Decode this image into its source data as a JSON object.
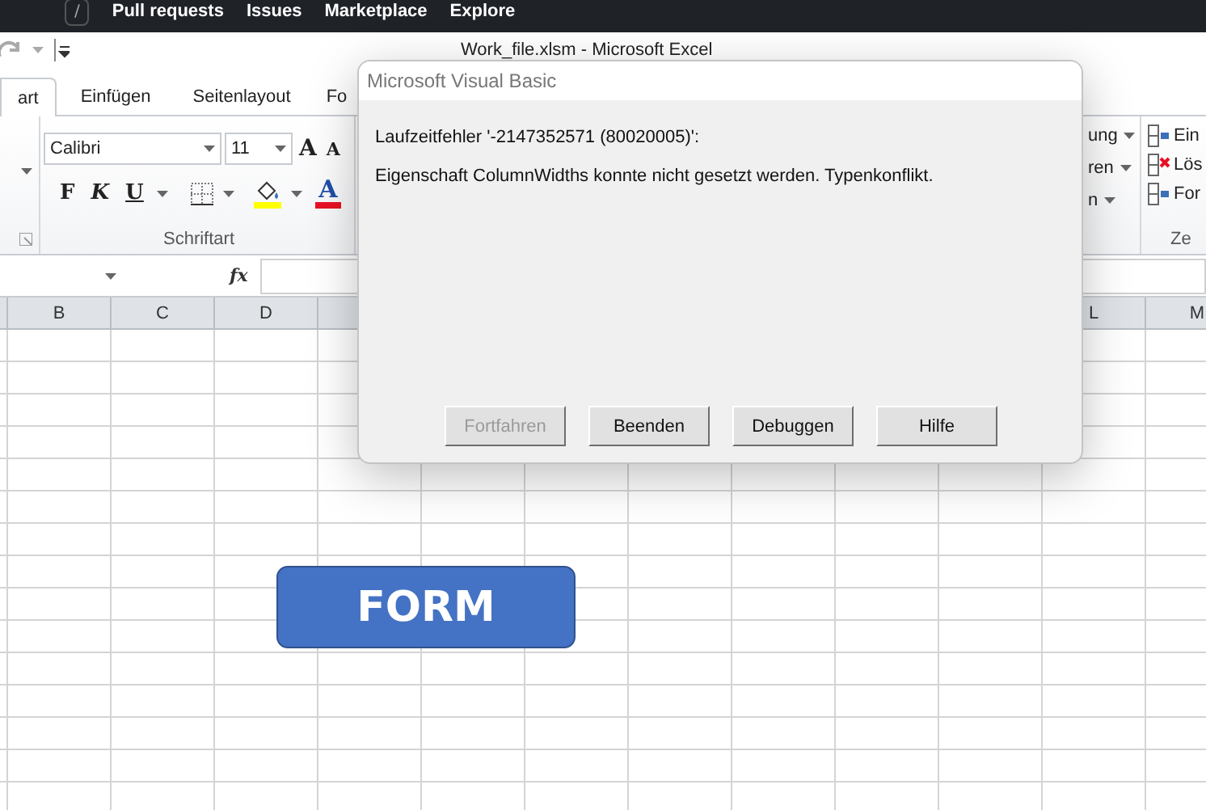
{
  "browser_bar": {
    "key_hint": "/",
    "links": [
      "Pull requests",
      "Issues",
      "Marketplace",
      "Explore"
    ]
  },
  "window": {
    "title": "Work_file.xlsm - Microsoft Excel"
  },
  "tabs": [
    {
      "label": "art",
      "selected": true
    },
    {
      "label": "Einfügen",
      "selected": false
    },
    {
      "label": "Seitenlayout",
      "selected": false
    },
    {
      "label": "Fo",
      "selected": false
    }
  ],
  "font_group": {
    "font": "Calibri",
    "size": "11",
    "grow": "A",
    "shrink": "A",
    "bold": "F",
    "italic": "K",
    "underline": "U",
    "font_color": "A",
    "label": "Schriftart"
  },
  "styles_group": {
    "items": [
      "ung",
      "ren",
      "n"
    ]
  },
  "cells_group": {
    "items": [
      "Ein",
      "Lös",
      "For"
    ],
    "label": "Ze"
  },
  "formula_bar": {
    "fx": "fx"
  },
  "sheet": {
    "columns_left": [
      "B",
      "C",
      "D"
    ],
    "columns_right": [
      "L",
      "M"
    ]
  },
  "shape": {
    "label": "FORM"
  },
  "dialog": {
    "title": "Microsoft Visual Basic",
    "error": "Laufzeitfehler '-2147352571 (80020005)':",
    "message": "Eigenschaft ColumnWidths konnte nicht gesetzt werden. Typenkonflikt.",
    "buttons": [
      {
        "label": "Fortfahren",
        "disabled": true
      },
      {
        "label": "Beenden",
        "disabled": false
      },
      {
        "label": "Debuggen",
        "disabled": false
      },
      {
        "label": "Hilfe",
        "disabled": false
      }
    ]
  }
}
